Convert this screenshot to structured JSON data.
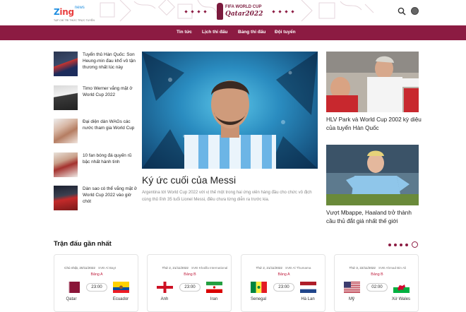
{
  "header": {
    "logo_main_z": "Z",
    "logo_main_ing": "ing",
    "logo_news": "news",
    "logo_sub": "TẠP CHÍ TRI THỨC TRỰC TUYẾN",
    "wc_line1": "FIFA WORLD CUP",
    "wc_line2": "Qatar2022"
  },
  "nav": {
    "items": [
      "Tin tức",
      "Lịch thi đấu",
      "Bảng thi đấu",
      "Đội tuyển"
    ]
  },
  "left_list": [
    {
      "title": "Tuyển thủ Hàn Quốc: Son Heung-min đau khổ vô tận thương nhất lúc này"
    },
    {
      "title": "Timo Werner vắng mặt ở World Cup 2022"
    },
    {
      "title": "Đại diện dàn WAGs các nước tham gia World Cup"
    },
    {
      "title": "10 fan bóng đá quyến rũ bậc nhất hành tinh"
    },
    {
      "title": "Dàn sao có thể vắng mặt ở World Cup 2022 vào giờ chót"
    }
  ],
  "feature": {
    "title": "Ký ức cuối của Messi",
    "desc": "Argentina tới World Cup 2022 với vị thế một trong hai ứng viên hàng đầu cho chức vô địch cùng thủ lĩnh 35 tuổi Lionel Messi, điều chưa từng diễn ra trước kia."
  },
  "right_cards": [
    {
      "title": "HLV Park và World Cup 2002 kỳ diệu của tuyển Hàn Quốc"
    },
    {
      "title": "Vượt Mbappe, Haaland trở thành cầu thủ đắt giá nhất thế giới"
    }
  ],
  "matches_section": {
    "title": "Trận đấu gần nhất",
    "matches": [
      {
        "date": "Chủ nhật, 20/11/2022",
        "venue": "SVĐ Al Bayt",
        "group": "Bảng A",
        "time": "23:00",
        "home": "Qatar",
        "away": "Ecuador"
      },
      {
        "date": "Thứ 2, 21/11/2022",
        "venue": "SVĐ Khalifa International",
        "group": "Bảng B",
        "time": "23:00",
        "home": "Anh",
        "away": "Iran"
      },
      {
        "date": "Thứ 2, 21/11/2022",
        "venue": "SVĐ Al Thumama",
        "group": "Bảng A",
        "time": "23:00",
        "home": "Senegal",
        "away": "Hà Lan"
      },
      {
        "date": "Thứ 3, 22/11/2022",
        "venue": "SVĐ Ahmad Bin Ali",
        "group": "Bảng B",
        "time": "02:00",
        "home": "Mỹ",
        "away": "Xứ Wales"
      }
    ]
  },
  "colors": {
    "brand": "#8c1b42",
    "group_red": "#c0203f",
    "logo_blue": "#1f8ee0"
  },
  "icons": [
    "search-icon",
    "football-icon",
    "world-cup-emblem-icon"
  ]
}
